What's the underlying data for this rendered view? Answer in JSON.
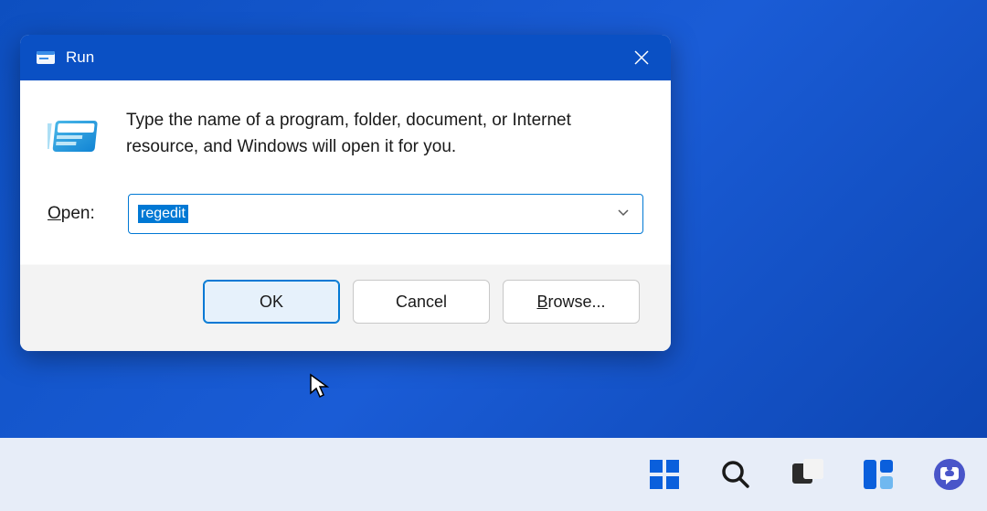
{
  "dialog": {
    "title": "Run",
    "description": "Type the name of a program, folder, document, or Internet resource, and Windows will open it for you.",
    "open_label_char": "O",
    "open_label_rest": "pen:",
    "input_value": "regedit",
    "buttons": {
      "ok": "OK",
      "cancel": "Cancel",
      "browse_char": "B",
      "browse_rest": "rowse..."
    }
  }
}
